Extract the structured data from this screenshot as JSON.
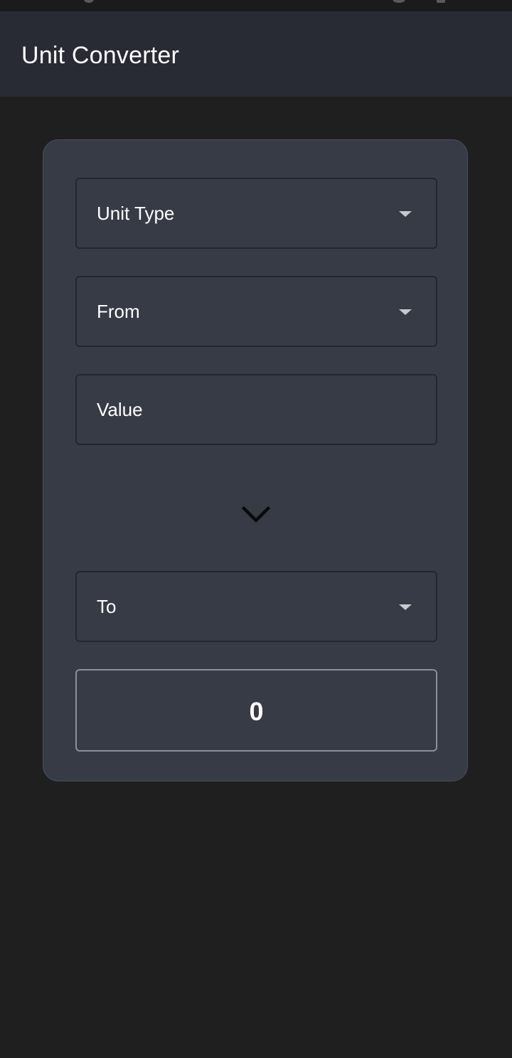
{
  "app_bar": {
    "title": "Unit Converter"
  },
  "form": {
    "unit_type": {
      "label": "Unit Type",
      "icon": "dropdown-arrow-icon"
    },
    "from": {
      "label": "From",
      "icon": "dropdown-arrow-icon"
    },
    "value": {
      "placeholder": "Value"
    },
    "swap": {
      "icon": "chevron-down-icon"
    },
    "to": {
      "label": "To",
      "icon": "dropdown-arrow-icon"
    },
    "result": {
      "value": "0"
    }
  },
  "colors": {
    "background": "#1f1f1f",
    "app_bar": "#282b34",
    "card": "#373b45",
    "field_border": "#23262d",
    "result_border": "#8c8f96",
    "text": "#ffffff"
  }
}
